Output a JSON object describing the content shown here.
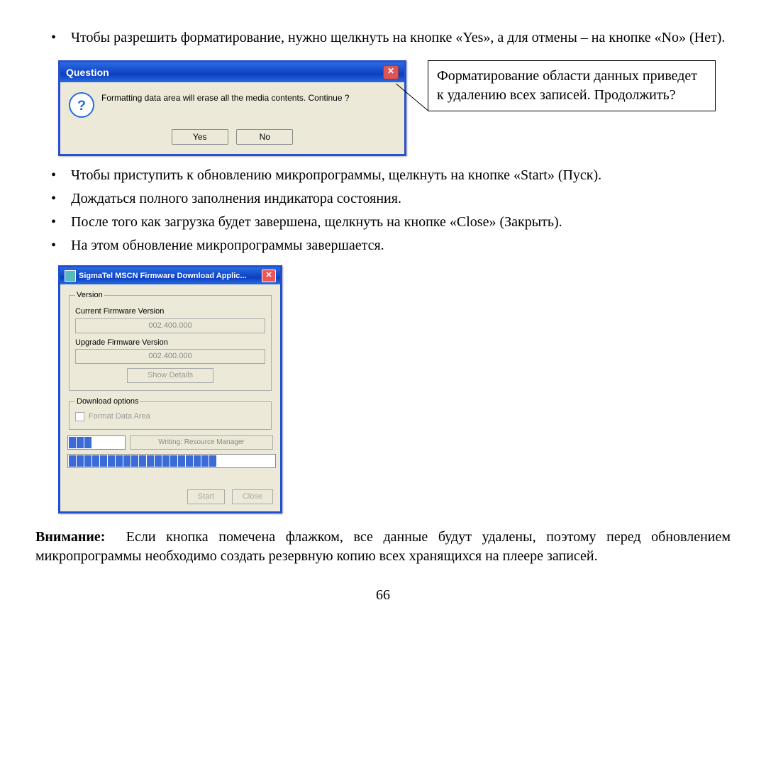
{
  "bullets_top": [
    "Чтобы разрешить форматирование, нужно щелкнуть на кнопке «Yes», а для отмены – на кнопке «No» (Нет)."
  ],
  "question_dialog": {
    "title": "Question",
    "message": "Formatting data area will erase all the media contents. Continue ?",
    "yes": "Yes",
    "no": "No"
  },
  "callout": "Форматирование области данных приведет к удалению всех записей. Продолжить?",
  "bullets_mid": [
    "Чтобы приступить к обновлению микропрограммы, щелкнуть на кнопке «Start» (Пуск).",
    "Дождаться полного заполнения индикатора состояния.",
    "После того как загрузка будет завершена, щелкнуть на кнопке «Close» (Закрыть).",
    "На этом обновление микропрограммы завершается."
  ],
  "sigmatel": {
    "title": "SigmaTel MSCN Firmware Download Applic...",
    "version_legend": "Version",
    "current_label": "Current Firmware Version",
    "current_value": "002.400.000",
    "upgrade_label": "Upgrade Firmware Version",
    "upgrade_value": "002.400.000",
    "show_details": "Show Details",
    "download_legend": "Download options",
    "format_checkbox": "Format Data Area",
    "status": "Writing: Resource Manager",
    "start": "Start",
    "close": "Close"
  },
  "warning_label": "Внимание:",
  "warning_text": "Если кнопка помечена флажком, все данные будут удалены, поэтому перед обновлением микропрограммы необходимо создать резервную копию всех хранящихся на плеере записей.",
  "page_number": "66"
}
